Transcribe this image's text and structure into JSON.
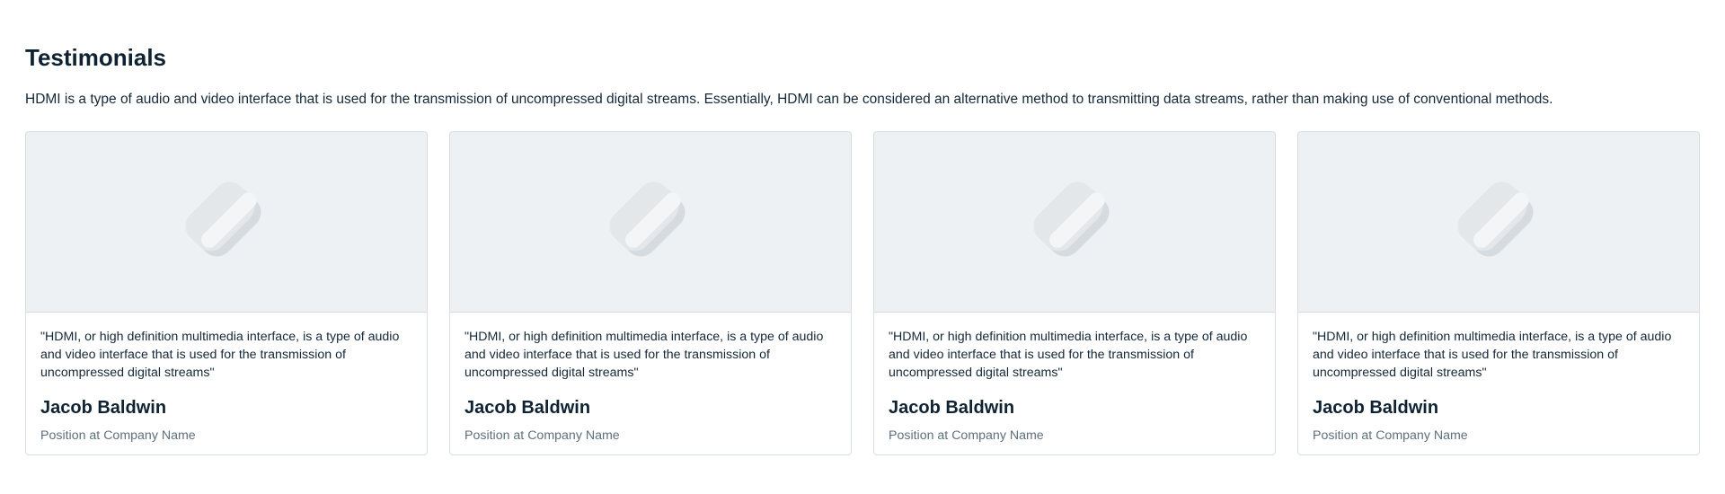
{
  "section": {
    "title": "Testimonials",
    "description": "HDMI is a type of audio and video interface that is used for the transmission of uncompressed digital streams. Essentially, HDMI can be considered an alternative method to transmitting data streams, rather than making use of conventional methods."
  },
  "cards": [
    {
      "image_icon": "image-placeholder-icon",
      "quote": "\"HDMI, or high definition multimedia interface, is a type of audio and video interface that is used for the transmission of uncompressed digital streams\"",
      "name": "Jacob Baldwin",
      "position": "Position at Company Name"
    },
    {
      "image_icon": "image-placeholder-icon",
      "quote": "\"HDMI, or high definition multimedia interface, is a type of audio and video interface that is used for the transmission of uncompressed digital streams\"",
      "name": "Jacob Baldwin",
      "position": "Position at Company Name"
    },
    {
      "image_icon": "image-placeholder-icon",
      "quote": "\"HDMI, or high definition multimedia interface, is a type of audio and video interface that is used for the transmission of uncompressed digital streams\"",
      "name": "Jacob Baldwin",
      "position": "Position at Company Name"
    },
    {
      "image_icon": "image-placeholder-icon",
      "quote": "\"HDMI, or high definition multimedia interface, is a type of audio and video interface that is used for the transmission of uncompressed digital streams\"",
      "name": "Jacob Baldwin",
      "position": "Position at Company Name"
    }
  ],
  "colors": {
    "heading": "#0f2233",
    "body_text": "#14283a",
    "muted_text": "#5e6f7d",
    "card_border": "#d7dde2",
    "media_background": "#edf1f4",
    "placeholder_light": "#e3e7ea",
    "placeholder_dark": "#d5dbdf"
  }
}
